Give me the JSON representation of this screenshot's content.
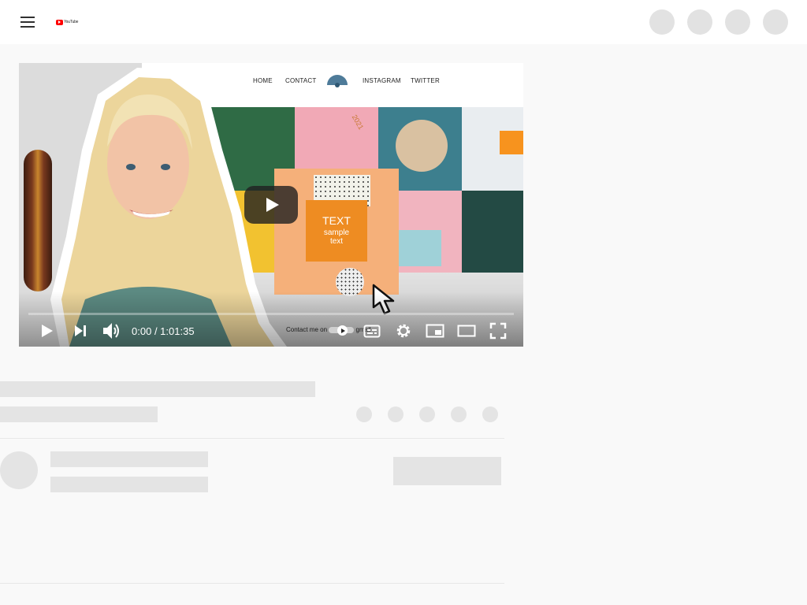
{
  "header": {
    "menu_icon": "hamburger-menu-icon",
    "logo_text": "YouTube",
    "brand_color": "#ff0000"
  },
  "video": {
    "site_nav": {
      "items": [
        "HOME",
        "CONTACT",
        "INSTAGRAM",
        "TWITTER"
      ],
      "accent": "#4e7b99"
    },
    "card": {
      "title": "TEXT",
      "line1": "sample",
      "line2": "text",
      "accent": "#ee8c22"
    },
    "tile_texts": {
      "notebook_year": "2021"
    },
    "overlay_text": "Contact me on",
    "overlay_suffix": "gmail",
    "player": {
      "current_time": "0:00",
      "duration": "1:01:35",
      "progress": 0,
      "play_icon": "play-icon",
      "next_icon": "skip-next-icon",
      "volume_icon": "volume-icon",
      "subtitles_icon": "subtitles-icon",
      "settings_icon": "gear-icon",
      "miniplayer_icon": "miniplayer-icon",
      "theater_icon": "theater-mode-icon",
      "fullscreen_icon": "fullscreen-icon"
    }
  }
}
